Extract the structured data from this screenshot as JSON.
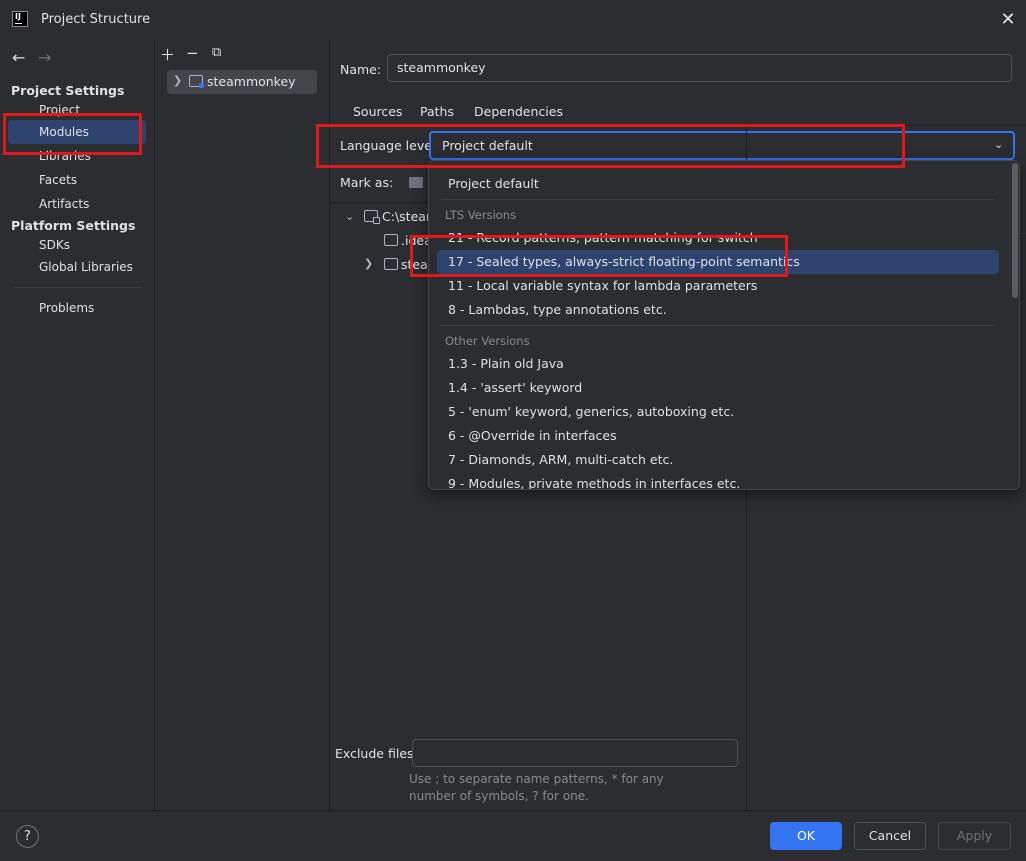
{
  "window": {
    "title": "Project Structure",
    "logo_text": "IJ"
  },
  "nav": {
    "project_settings_header": "Project Settings",
    "project_settings_items": [
      {
        "label": "Project"
      },
      {
        "label": "Modules"
      },
      {
        "label": "Libraries"
      },
      {
        "label": "Facets"
      },
      {
        "label": "Artifacts"
      }
    ],
    "platform_settings_header": "Platform Settings",
    "platform_settings_items": [
      {
        "label": "SDKs"
      },
      {
        "label": "Global Libraries"
      }
    ],
    "problems_label": "Problems",
    "selected": "Modules"
  },
  "modules": {
    "items": [
      {
        "label": "steammonkey"
      }
    ]
  },
  "module": {
    "name_label": "Name:",
    "name_value": "steammonkey",
    "tabs": [
      {
        "label": "Sources"
      },
      {
        "label": "Paths"
      },
      {
        "label": "Dependencies"
      }
    ],
    "active_tab": "Sources",
    "language_level_label": "Language level:",
    "language_level_value": "Project default",
    "mark_as_label": "Mark as:",
    "tree": {
      "root": "C:\\steam",
      "children": [
        {
          "label": ".idea"
        },
        {
          "label": "steam"
        }
      ]
    },
    "exclude_label": "Exclude files:",
    "exclude_value": "",
    "exclude_hint": "Use ; to separate name patterns, * for any number of symbols, ? for one."
  },
  "language_popup": {
    "project_default": "Project default",
    "lts_header": "LTS Versions",
    "lts_options": [
      {
        "label": "21 - Record patterns, pattern matching for switch"
      },
      {
        "label": "17 - Sealed types, always-strict floating-point semantics"
      },
      {
        "label": "11 - Local variable syntax for lambda parameters"
      },
      {
        "label": "8 - Lambdas, type annotations etc."
      }
    ],
    "other_header": "Other Versions",
    "other_options": [
      {
        "label": "1.3 - Plain old Java"
      },
      {
        "label": "1.4 - 'assert' keyword"
      },
      {
        "label": "5 - 'enum' keyword, generics, autoboxing etc."
      },
      {
        "label": "6 - @Override in interfaces"
      },
      {
        "label": "7 - Diamonds, ARM, multi-catch etc."
      },
      {
        "label": "9 - Modules, private methods in interfaces etc."
      }
    ],
    "highlighted": "17 - Sealed types, always-strict floating-point semantics"
  },
  "buttons": {
    "help": "?",
    "ok": "OK",
    "cancel": "Cancel",
    "apply": "Apply"
  },
  "colors": {
    "accent": "#3574f0",
    "selection": "#2e436e",
    "annotation": "#e0191b",
    "background": "#2b2d30"
  }
}
